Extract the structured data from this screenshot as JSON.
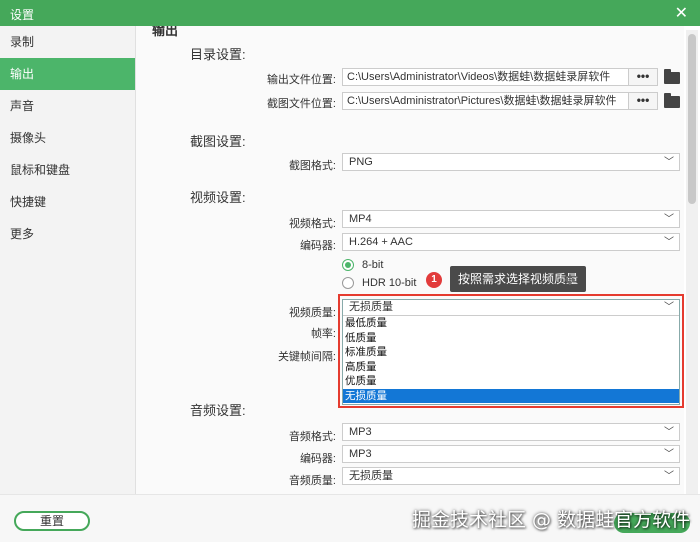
{
  "window": {
    "title": "设置",
    "close_glyph": "✕"
  },
  "sidebar": {
    "items": [
      {
        "label": "录制",
        "active": false
      },
      {
        "label": "输出",
        "active": true
      },
      {
        "label": "声音",
        "active": false
      },
      {
        "label": "摄像头",
        "active": false
      },
      {
        "label": "鼠标和键盘",
        "active": false
      },
      {
        "label": "快捷键",
        "active": false
      },
      {
        "label": "更多",
        "active": false
      }
    ]
  },
  "main": {
    "header": "输出",
    "directory": {
      "title": "目录设置:",
      "output_label": "输出文件位置:",
      "output_path": "C:\\Users\\Administrator\\Videos\\数据蛙\\数据蛙录屏软件",
      "screenshot_label": "截图文件位置:",
      "screenshot_path": "C:\\Users\\Administrator\\Pictures\\数据蛙\\数据蛙录屏软件",
      "browse_label": "•••"
    },
    "screenshot": {
      "title": "截图设置:",
      "format_label": "截图格式:",
      "format_value": "PNG"
    },
    "video": {
      "title": "视频设置:",
      "format_label": "视频格式:",
      "format_value": "MP4",
      "encoder_label": "编码器:",
      "encoder_value": "H.264 + AAC",
      "bit_8_label": "8-bit",
      "hdr_label": "HDR 10-bit",
      "quality_label": "视频质量:",
      "quality_value": "无损质量",
      "framerate_label": "帧率:",
      "keyframe_label": "关键帧间隔:",
      "quality_options": [
        "最低质量",
        "低质量",
        "标准质量",
        "高质量",
        "优质量",
        "无损质量"
      ],
      "selected_option": "无损质量"
    },
    "annotation": {
      "badge": "1",
      "tooltip": "按照需求选择视频质量"
    },
    "audio": {
      "title": "音频设置:",
      "format_label": "音频格式:",
      "format_value": "MP3",
      "encoder_label": "编码器:",
      "encoder_value": "MP3",
      "quality_label": "音频质量:",
      "quality_value": "无损质量"
    }
  },
  "footer": {
    "reset_label": "重置",
    "watermark": "掘金技术社区 @ 数据蛙官方软件"
  },
  "colors": {
    "accent": "#45a85a",
    "sidebar_active": "#4cb56a",
    "highlight_border": "#e53b2f",
    "dropdown_selected": "#1377d6"
  }
}
